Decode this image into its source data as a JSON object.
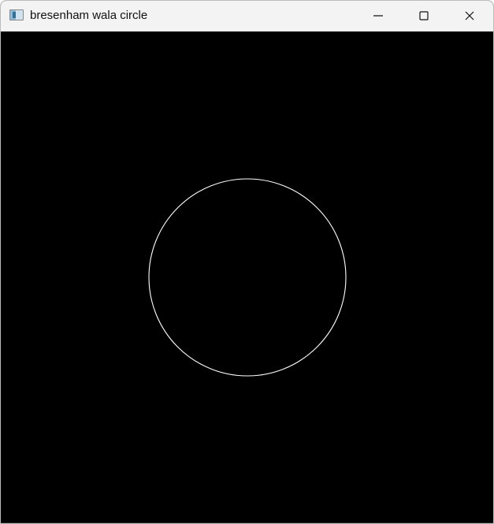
{
  "window": {
    "title": "bresenham wala circle",
    "icon": "app-window-icon",
    "controls": {
      "minimize_icon": "minimize-icon",
      "maximize_icon": "maximize-icon",
      "close_icon": "close-icon"
    }
  },
  "canvas": {
    "background": "#000000",
    "shape": "circle",
    "stroke_color": "#ffffff"
  }
}
